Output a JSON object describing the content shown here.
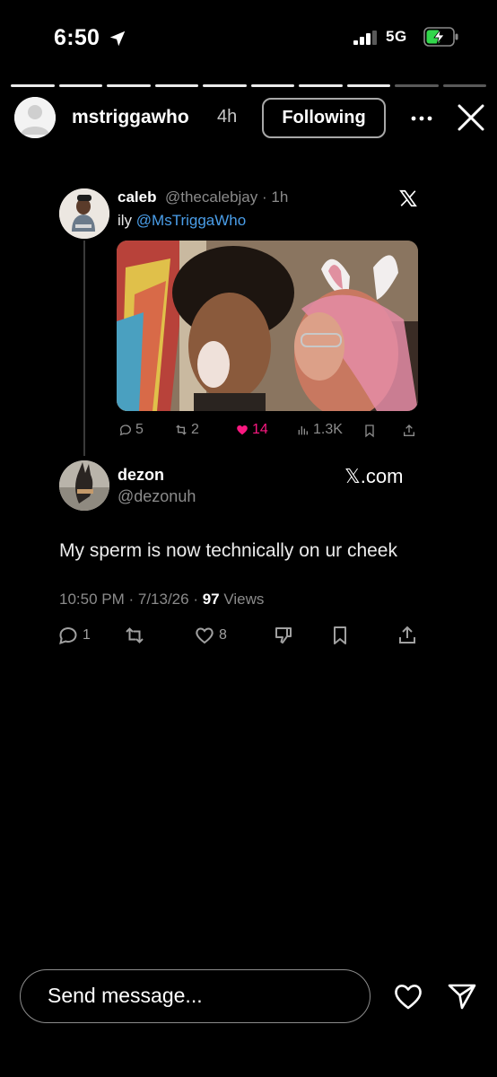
{
  "status_bar": {
    "time": "6:50",
    "network": "5G"
  },
  "story": {
    "progress_segments": 10,
    "progress_completed": 8,
    "username": "mstriggawho",
    "time_ago": "4h",
    "follow_label": "Following"
  },
  "tweet_original": {
    "name": "caleb",
    "handle_time": "@thecalebjay · 1h",
    "text": "ily ",
    "mention": "@MsTriggaWho",
    "metrics": {
      "replies": "5",
      "retweets": "2",
      "likes": "14",
      "views": "1.3K"
    }
  },
  "tweet_reply": {
    "name": "dezon",
    "handle": "@dezonuh",
    "source": "𝕏.com",
    "text": "My sperm is now technically on ur cheek",
    "meta_prefix": "10:50 PM · 7/13/26 · ",
    "views_count": "97",
    "views_label": " Views",
    "actions": {
      "replies": "1",
      "likes": "8"
    }
  },
  "bottom_bar": {
    "message_placeholder": "Send message..."
  },
  "colors": {
    "background": "#000000",
    "link": "#4a9ee9",
    "like_active": "#f91880",
    "battery_charging": "#32d74b",
    "muted_text": "#8b8b8b"
  },
  "icons": [
    "location-arrow-icon",
    "signal-icon",
    "battery-icon",
    "more-icon",
    "close-icon",
    "x-logo-icon",
    "reply-icon",
    "retweet-icon",
    "like-icon",
    "views-icon",
    "bookmark-icon",
    "share-icon",
    "dislike-icon",
    "heart-icon",
    "send-icon"
  ]
}
